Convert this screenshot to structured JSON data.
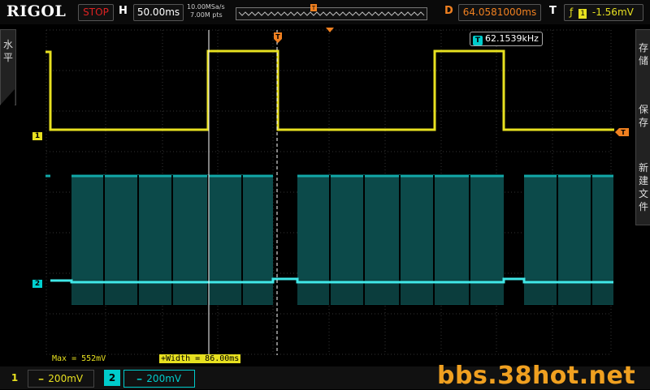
{
  "top": {
    "logo": "RIGOL",
    "status": "STOP",
    "h_label": "H",
    "timebase": "50.00ms",
    "sample_rate": "10.00MSa/s",
    "mem_depth": "7.00M pts",
    "d_label": "D",
    "delay": "64.0581000ms",
    "t_label": "T",
    "trigger_source": "1",
    "trigger_level": "-1.56mV"
  },
  "left_menu": {
    "label": "水平"
  },
  "right_menu": {
    "items": [
      "存储",
      "保存",
      "新建文件"
    ]
  },
  "channels": [
    {
      "id": "1",
      "scale": "200mV",
      "color": "#e7e020",
      "marker": "1"
    },
    {
      "id": "2",
      "scale": "200mV",
      "color": "#00d0d0",
      "marker": "2"
    }
  ],
  "measurements": {
    "max": "Max = 552mV",
    "width": "+Width = 86.00ms",
    "frequency": "62.1539kHz",
    "freq_badge": "T"
  },
  "watermark": "bbs.38hot.net",
  "colors": {
    "ch1": "#e7e020",
    "ch2": "#00d0d0",
    "delay": "#f08020",
    "stop": "#dd2222"
  }
}
